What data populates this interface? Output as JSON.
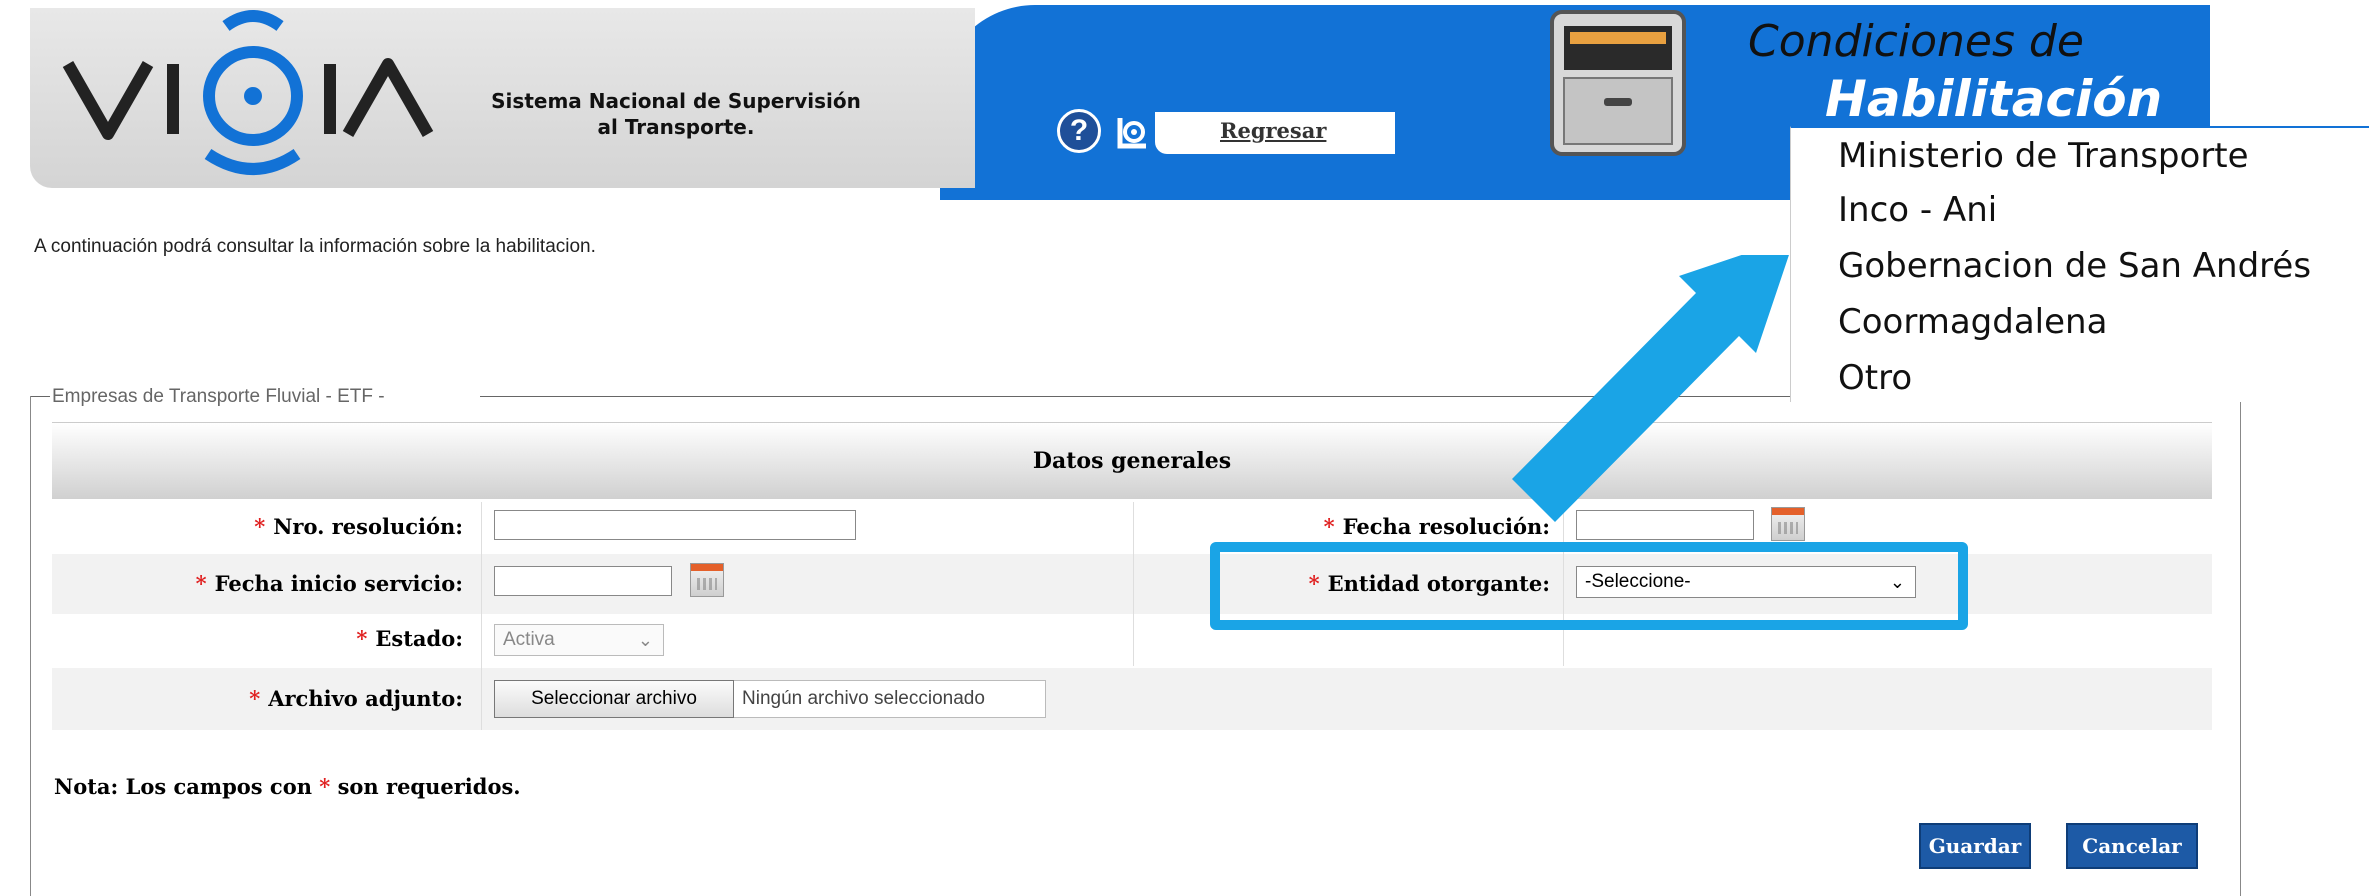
{
  "header": {
    "logo_text": "VIGIA",
    "subtitle": "Sistema Nacional de Supervisión\nal Transporte.",
    "help_icon": "question-circle-icon",
    "back_icon": "back-arrow-icon",
    "back_label": "Regresar",
    "title_line1": "Condiciones de",
    "title_line2": "Habilitación",
    "cabinet_icon": "file-cabinet-icon"
  },
  "intro_text": "A continuación podrá consultar la información sobre la habilitacion.",
  "fieldset": {
    "legend": "Empresas de Transporte Fluvial - ETF -"
  },
  "form": {
    "panel_title": "Datos generales",
    "required_mark": "*",
    "nro_resolucion_label": "Nro. resolución:",
    "nro_resolucion_value": "",
    "fecha_resolucion_label": "Fecha resolución:",
    "fecha_resolucion_value": "",
    "fecha_inicio_label": "Fecha inicio servicio:",
    "fecha_inicio_value": "",
    "entidad_label": "Entidad otorgante:",
    "entidad_selected": "-Seleccione-",
    "estado_label": "Estado:",
    "estado_selected": "Activa",
    "archivo_label": "Archivo adjunto:",
    "file_button": "Seleccionar archivo",
    "file_status": "Ningún archivo seleccionado"
  },
  "note": {
    "prefix": "Nota: Los campos con",
    "star": "*",
    "suffix": "son requeridos."
  },
  "buttons": {
    "save": "Guardar",
    "cancel": "Cancelar"
  },
  "dropdown_options": [
    "Ministerio de Transporte",
    "Inco - Ani",
    "Gobernacion de San Andrés",
    "Coormagdalena",
    "Otro"
  ],
  "colors": {
    "header_blue": "#1272d6",
    "highlight": "#1aa4e6",
    "required": "#e02020",
    "button": "#1d5aa6"
  }
}
